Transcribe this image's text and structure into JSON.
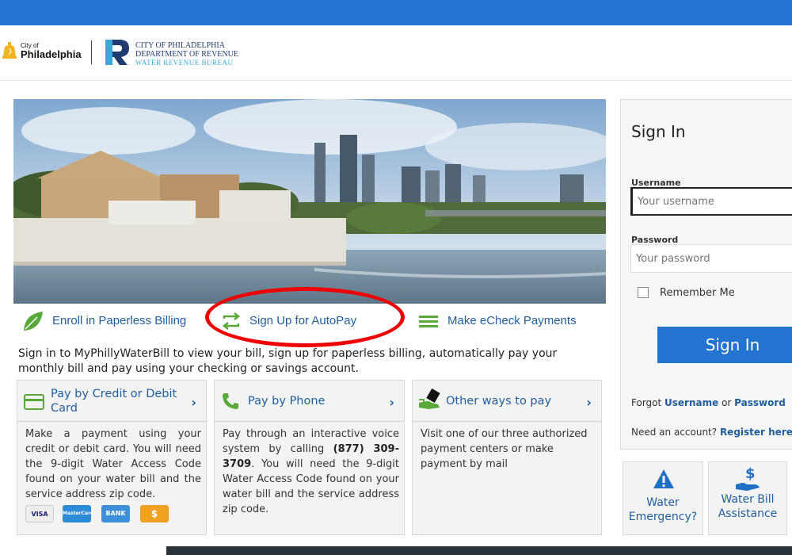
{
  "header": {
    "city_small": "City of",
    "city_name": "Philadelphia",
    "dept_line1": "CITY OF PHILADELPHIA",
    "dept_line2": "DEPARTMENT OF REVENUE",
    "dept_line3": "WATER REVENUE BUREAU"
  },
  "actions": {
    "paperless": "Enroll in Paperless Billing",
    "autopay": "Sign Up for AutoPay",
    "echeck": "Make eCheck Payments"
  },
  "intro": "Sign in to MyPhillyWaterBill to view your bill, sign up for paperless billing, automatically pay your monthly bill and pay using your checking or savings account.",
  "cards": {
    "credit": {
      "title": "Pay by Credit or Debit Card",
      "body": "Make a payment using your credit or debit card. You will need the 9-digit Water Access Code found on your water bill and the service address zip code.",
      "badges": [
        "VISA",
        "MasterCard",
        "BANK",
        "$"
      ]
    },
    "phone": {
      "title": "Pay by Phone",
      "body_before": "Pay through an interactive voice system by calling ",
      "phone": "(877) 309-3709",
      "body_after": ". You will need the 9-digit Water Access Code found on your water bill and the service address zip code."
    },
    "other": {
      "title": "Other ways to pay",
      "body": "Visit one of our three authorized payment centers or make payment by mail"
    }
  },
  "signin": {
    "title": "Sign In",
    "username_label": "Username",
    "username_placeholder": "Your username",
    "password_label": "Password",
    "password_placeholder": "Your password",
    "remember": "Remember Me",
    "button": "Sign In",
    "forgot_prefix": "Forgot ",
    "forgot_username": "Username",
    "forgot_or": " or ",
    "forgot_password": "Password",
    "need_account": "Need an account? ",
    "register": "Register here"
  },
  "tiles": {
    "emergency": "Water Emergency?",
    "assistance": "Water Bill Assistance"
  },
  "colors": {
    "brand_blue": "#2373d1",
    "link_blue": "#1f5e9c",
    "leaf_green": "#5aa83a",
    "annotation_red": "#ee0000"
  }
}
